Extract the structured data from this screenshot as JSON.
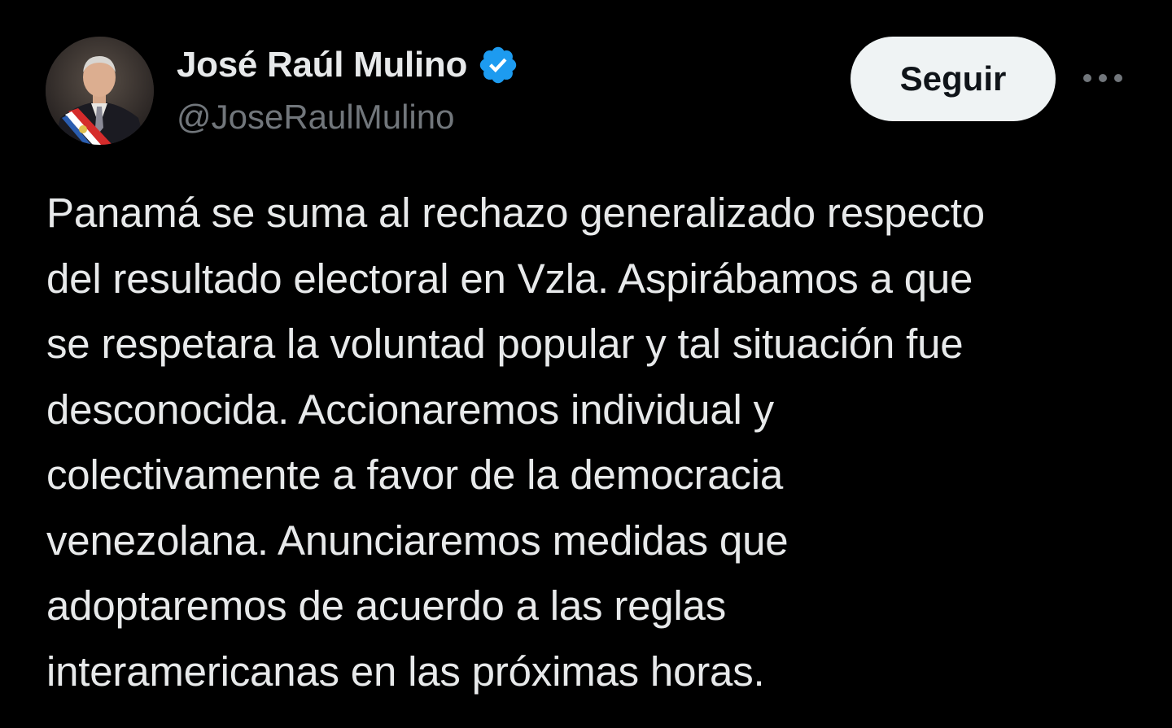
{
  "author": {
    "display_name": "José Raúl Mulino",
    "handle": "@JoseRaulMulino",
    "verified": true,
    "avatar_icon": "profile-photo"
  },
  "actions": {
    "follow_label": "Seguir",
    "more_icon": "more-horizontal-icon"
  },
  "tweet": {
    "text": "Panamá se suma al rechazo generalizado respecto\ndel resultado electoral en Vzla. Aspirábamos a que\nse respetara la voluntad popular y tal situación fue\ndesconocida. Accionaremos individual y\ncolectivamente a favor de la democracia\nvenezolana. Anunciaremos medidas que\nadoptaremos de acuerdo a las reglas\ninteramericanas en las próximas horas."
  },
  "colors": {
    "background": "#000000",
    "text_primary": "#e7e9ea",
    "text_secondary": "#71767b",
    "verified_blue": "#1d9bf0",
    "follow_button_bg": "#eff3f4",
    "follow_button_text": "#0f1419"
  }
}
